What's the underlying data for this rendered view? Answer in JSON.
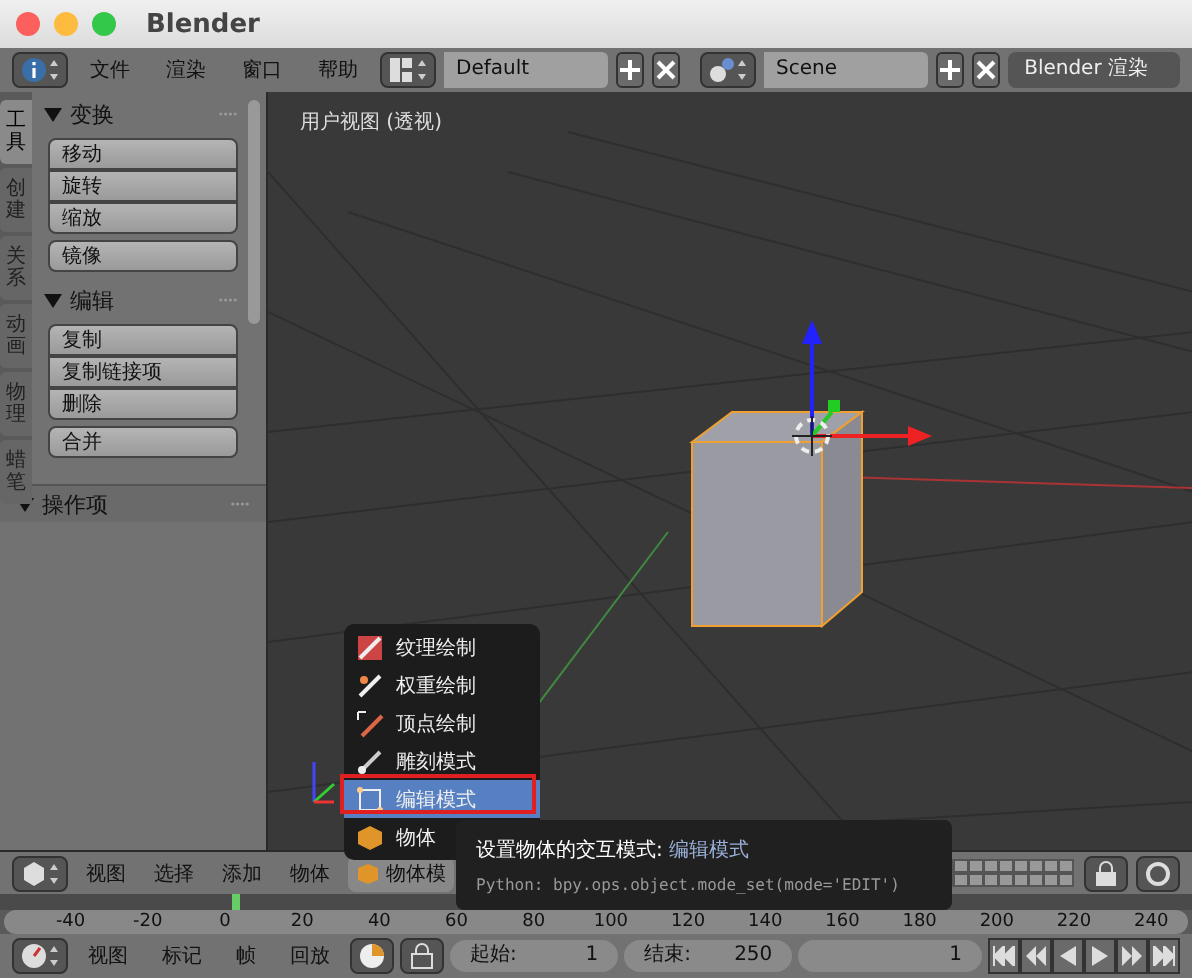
{
  "window": {
    "title": "Blender"
  },
  "top_header": {
    "menus": [
      "文件",
      "渲染",
      "窗口",
      "帮助"
    ],
    "layout": "Default",
    "scene": "Scene",
    "render_engine": "Blender 渲染"
  },
  "tool_shelf": {
    "tabs": [
      {
        "label": "工具",
        "selected": true
      },
      {
        "label": "创建",
        "selected": false
      },
      {
        "label": "关系",
        "selected": false
      },
      {
        "label": "动画",
        "selected": false
      },
      {
        "label": "物理",
        "selected": false
      },
      {
        "label": "蜡笔",
        "selected": false
      }
    ],
    "panels": [
      {
        "title": "变换",
        "expanded": true,
        "groups": [
          [
            "移动",
            "旋转",
            "缩放"
          ],
          [
            "镜像"
          ]
        ]
      },
      {
        "title": "编辑",
        "expanded": true,
        "groups": [
          [
            "复制",
            "复制链接项",
            "删除"
          ],
          [
            "合并"
          ]
        ]
      }
    ],
    "operator_panel": {
      "title": "操作项",
      "expanded": true
    }
  },
  "viewport": {
    "label": "用户视图 (透视)"
  },
  "mode_menu": {
    "items": [
      {
        "kind": "texture",
        "label": "纹理绘制",
        "selected": false
      },
      {
        "kind": "weight",
        "label": "权重绘制",
        "selected": false
      },
      {
        "kind": "vertex",
        "label": "顶点绘制",
        "selected": false
      },
      {
        "kind": "sculpt",
        "label": "雕刻模式",
        "selected": false
      },
      {
        "kind": "edit",
        "label": "编辑模式",
        "selected": true
      },
      {
        "kind": "object",
        "label": "物体",
        "selected": false
      }
    ]
  },
  "tooltip": {
    "title": "设置物体的交互模式:",
    "value": "编辑模式",
    "python": "Python: bpy.ops.object.mode_set(mode='EDIT')"
  },
  "view_header": {
    "menus": [
      "视图",
      "选择",
      "添加",
      "物体"
    ],
    "mode": "物体模"
  },
  "timeline": {
    "ticks": [
      "-40",
      "-20",
      "0",
      "20",
      "40",
      "60",
      "80",
      "100",
      "120",
      "140",
      "160",
      "180",
      "200",
      "220",
      "240"
    ]
  },
  "timeline_header": {
    "menus": [
      "视图",
      "标记",
      "帧",
      "回放"
    ],
    "start_label": "起始:",
    "start": "1",
    "end_label": "结束:",
    "end": "250",
    "current": "1"
  }
}
